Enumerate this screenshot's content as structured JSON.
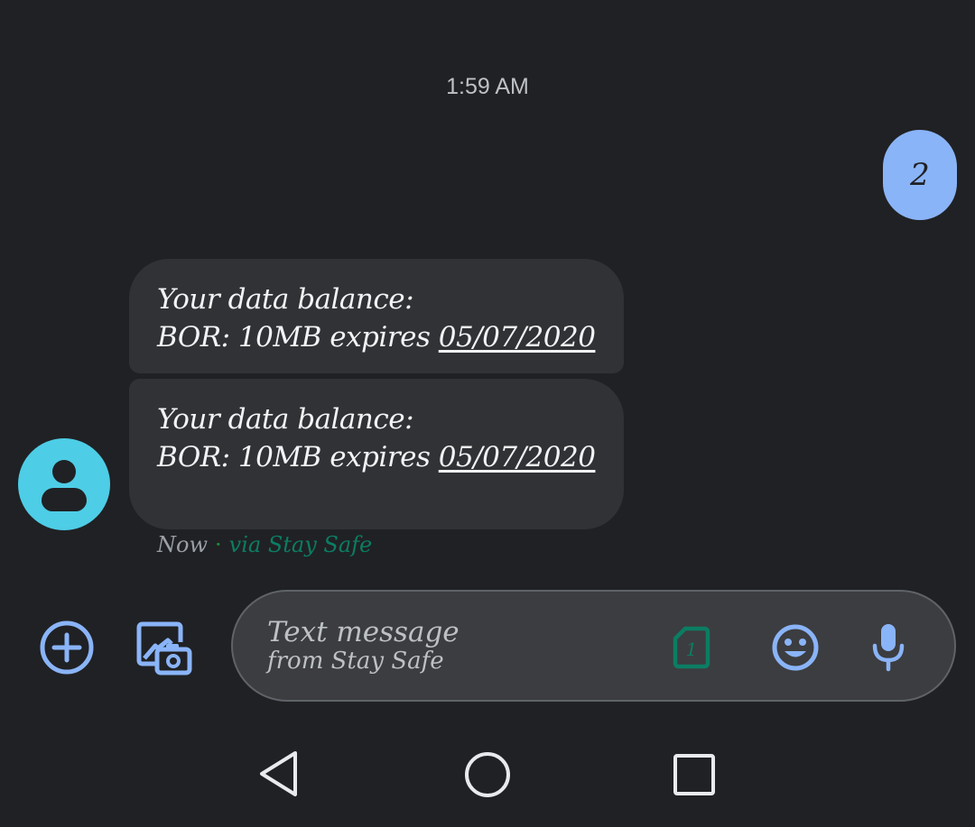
{
  "conversation": {
    "timestamp": "1:59 AM",
    "sent_message": "2",
    "received_messages": [
      {
        "line1": "Your data balance:",
        "line2_prefix": "BOR: 10MB expires ",
        "line2_date": "05/07/2020"
      },
      {
        "line1": "Your data balance:",
        "line2_prefix": "BOR: 10MB expires ",
        "line2_date": "05/07/2020"
      }
    ],
    "meta": {
      "time": "Now",
      "separator": "·",
      "via": "via Stay Safe"
    }
  },
  "compose": {
    "placeholder_line1": "Text message",
    "placeholder_line2": "from Stay Safe",
    "sim_number": "1"
  },
  "icons": {
    "add": "add-circle-icon",
    "gallery": "gallery-camera-icon",
    "sim": "sim-card-icon",
    "emoji": "emoji-icon",
    "mic": "microphone-icon",
    "back": "back-triangle-icon",
    "home": "home-circle-icon",
    "recents": "recents-square-icon",
    "avatar": "person-icon"
  },
  "colors": {
    "background": "#202124",
    "accent": "#8ab4f8",
    "bubble": "#313235",
    "avatar": "#4ecde6",
    "sim": "#0b7d63"
  }
}
